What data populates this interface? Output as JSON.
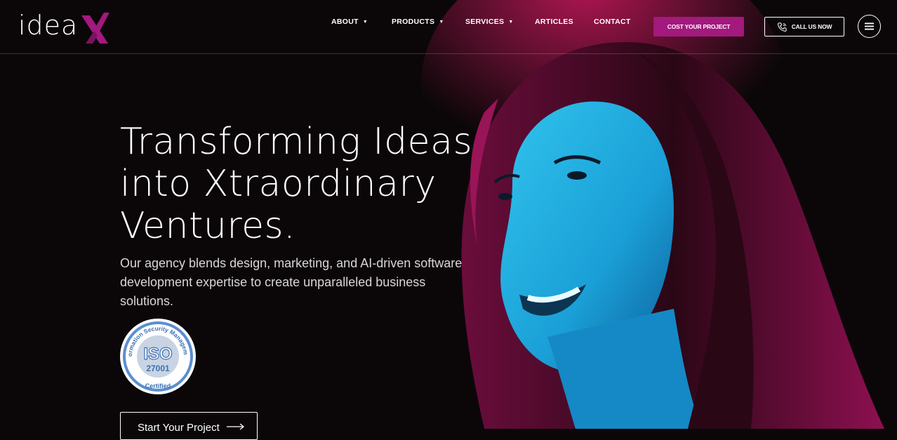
{
  "brand": {
    "logo_text": "idea",
    "logo_mark": "X",
    "accent": "#a3197e"
  },
  "nav": {
    "items": [
      {
        "label": "ABOUT",
        "dropdown": true
      },
      {
        "label": "PRODUCTS",
        "dropdown": true
      },
      {
        "label": "SERVICES",
        "dropdown": true
      },
      {
        "label": "ARTICLES",
        "dropdown": false
      },
      {
        "label": "CONTACT",
        "dropdown": false
      }
    ],
    "cost_button": "COST YOUR PROJECT",
    "call_button": "CALL US NOW",
    "menu_icon": "hamburger-icon",
    "phone_icon": "phone-icon"
  },
  "hero": {
    "headline_lines": [
      "Transforming Ideas",
      "into Xtraordinary",
      "Ventures."
    ],
    "subtext": "Our agency blends design, marketing, and AI-driven software development expertise to create unparalleled business solutions.",
    "badge": {
      "top_text": "Information Security Management",
      "center": "ISO",
      "number": "27001",
      "bottom_text": "Certified"
    },
    "cta": "Start Your Project"
  }
}
